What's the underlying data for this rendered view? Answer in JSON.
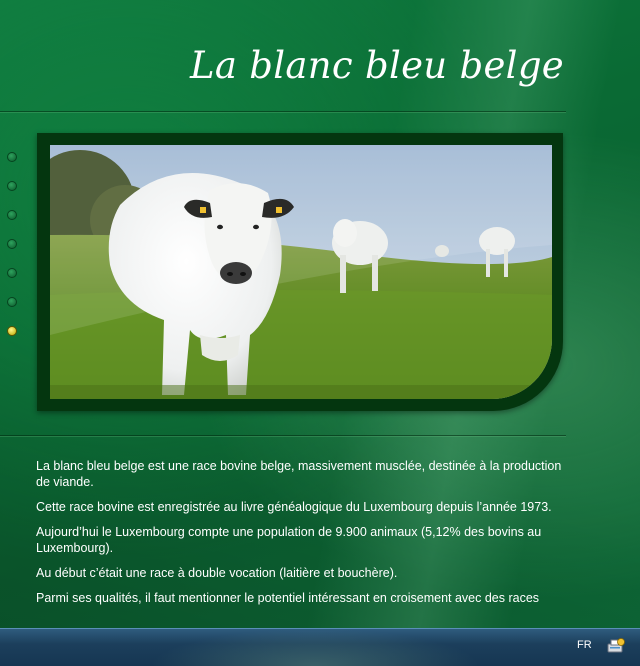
{
  "page": {
    "title": "La blanc bleu belge"
  },
  "nav": {
    "dots": [
      {
        "active": false
      },
      {
        "active": false
      },
      {
        "active": false
      },
      {
        "active": false
      },
      {
        "active": false
      },
      {
        "active": false
      },
      {
        "active": true
      }
    ]
  },
  "content": {
    "paragraphs": [
      "La blanc bleu belge est une race bovine belge, massivement musclée, destinée à la production de viande.",
      "Cette race bovine est enregistrée au livre généalogique du Luxembourg depuis l’année 1973.",
      "Aujourd’hui le Luxembourg compte une population de 9.900 animaux (5,12% des bovins au Luxembourg).",
      "Au début c’était une race à double vocation (laitière et bouchère).",
      "Parmi ses qualités, il faut mentionner le potentiel intéressant en croisement avec des races"
    ]
  },
  "taskbar": {
    "language": "FR",
    "tray_icon": "network-printer-icon"
  },
  "colors": {
    "background": "#0b6a34",
    "frame": "#04360f",
    "active_dot": "#e6d84a"
  }
}
